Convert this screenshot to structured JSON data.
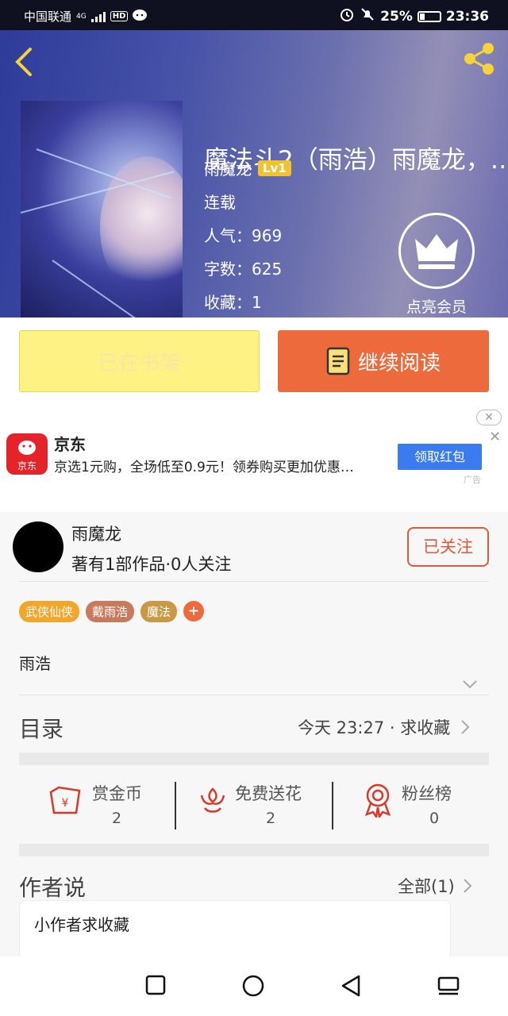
{
  "status_bar": {
    "carrier": "中国联通",
    "network": "4G",
    "hd": "HD",
    "battery": "25%",
    "time": "23:36"
  },
  "book": {
    "title": "魔法斗2（雨浩）雨魔龙，…",
    "author": "雨魔龙",
    "level": "Lv1",
    "status": "连载",
    "popularity": "人气：969",
    "word_count": "字数：625",
    "favorites": "收藏：1",
    "vip_label": "点亮会员"
  },
  "actions": {
    "on_shelf": "已在书架",
    "continue_reading": "继续阅读"
  },
  "ad": {
    "logo_text": "京东",
    "name": "京东",
    "desc": "京选1元购，全场低至0.9元！领券购买更加优惠…",
    "button": "领取红包",
    "mark": "广告"
  },
  "author_card": {
    "name": "雨魔龙",
    "stats": "著有1部作品·0人关注",
    "follow": "已关注"
  },
  "tags": [
    {
      "label": "武侠仙侠",
      "color": "#f0a72c"
    },
    {
      "label": "戴雨浩",
      "color": "#c87a5c"
    },
    {
      "label": "魔法",
      "color": "#c89a46"
    }
  ],
  "intro": "雨浩",
  "toc": {
    "title": "目录",
    "update": "今天 23:27 · 求收藏"
  },
  "stats": [
    {
      "label": "赏金币",
      "value": "2",
      "icon": "coin-icon"
    },
    {
      "label": "免费送花",
      "value": "2",
      "icon": "flower-icon"
    },
    {
      "label": "粉丝榜",
      "value": "0",
      "icon": "medal-icon"
    }
  ],
  "author_says": {
    "title": "作者说",
    "all": "全部(1)",
    "text": "小作者求收藏"
  },
  "colors": {
    "accent": "#ec6a3c",
    "shelf_yellow": "#fdf283",
    "icon_red": "#d9392b"
  }
}
